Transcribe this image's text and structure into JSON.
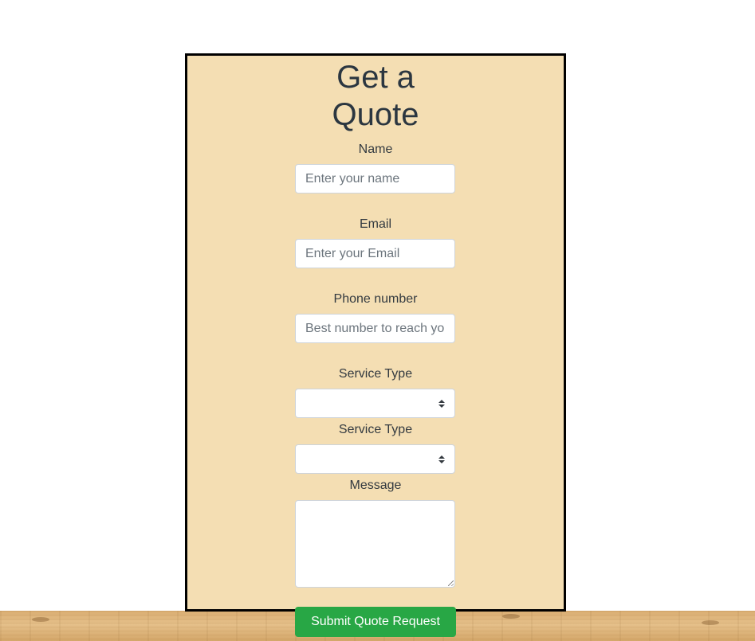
{
  "form": {
    "title_line1": "Get a",
    "title_line2": "Quote",
    "name_label": "Name",
    "name_placeholder": "Enter your name",
    "email_label": "Email",
    "email_placeholder": "Enter your Email",
    "phone_label": "Phone number",
    "phone_placeholder": "Best number to reach you",
    "service_type_label_1": "Service Type",
    "service_type_value_1": "",
    "service_type_label_2": "Service Type",
    "service_type_value_2": "",
    "message_label": "Message",
    "message_value": "",
    "submit_label": "Submit Quote Request"
  },
  "colors": {
    "panel_background": "#f4deb3",
    "panel_border": "#000000",
    "submit_background": "#28a745",
    "title_text": "#2b3640"
  }
}
